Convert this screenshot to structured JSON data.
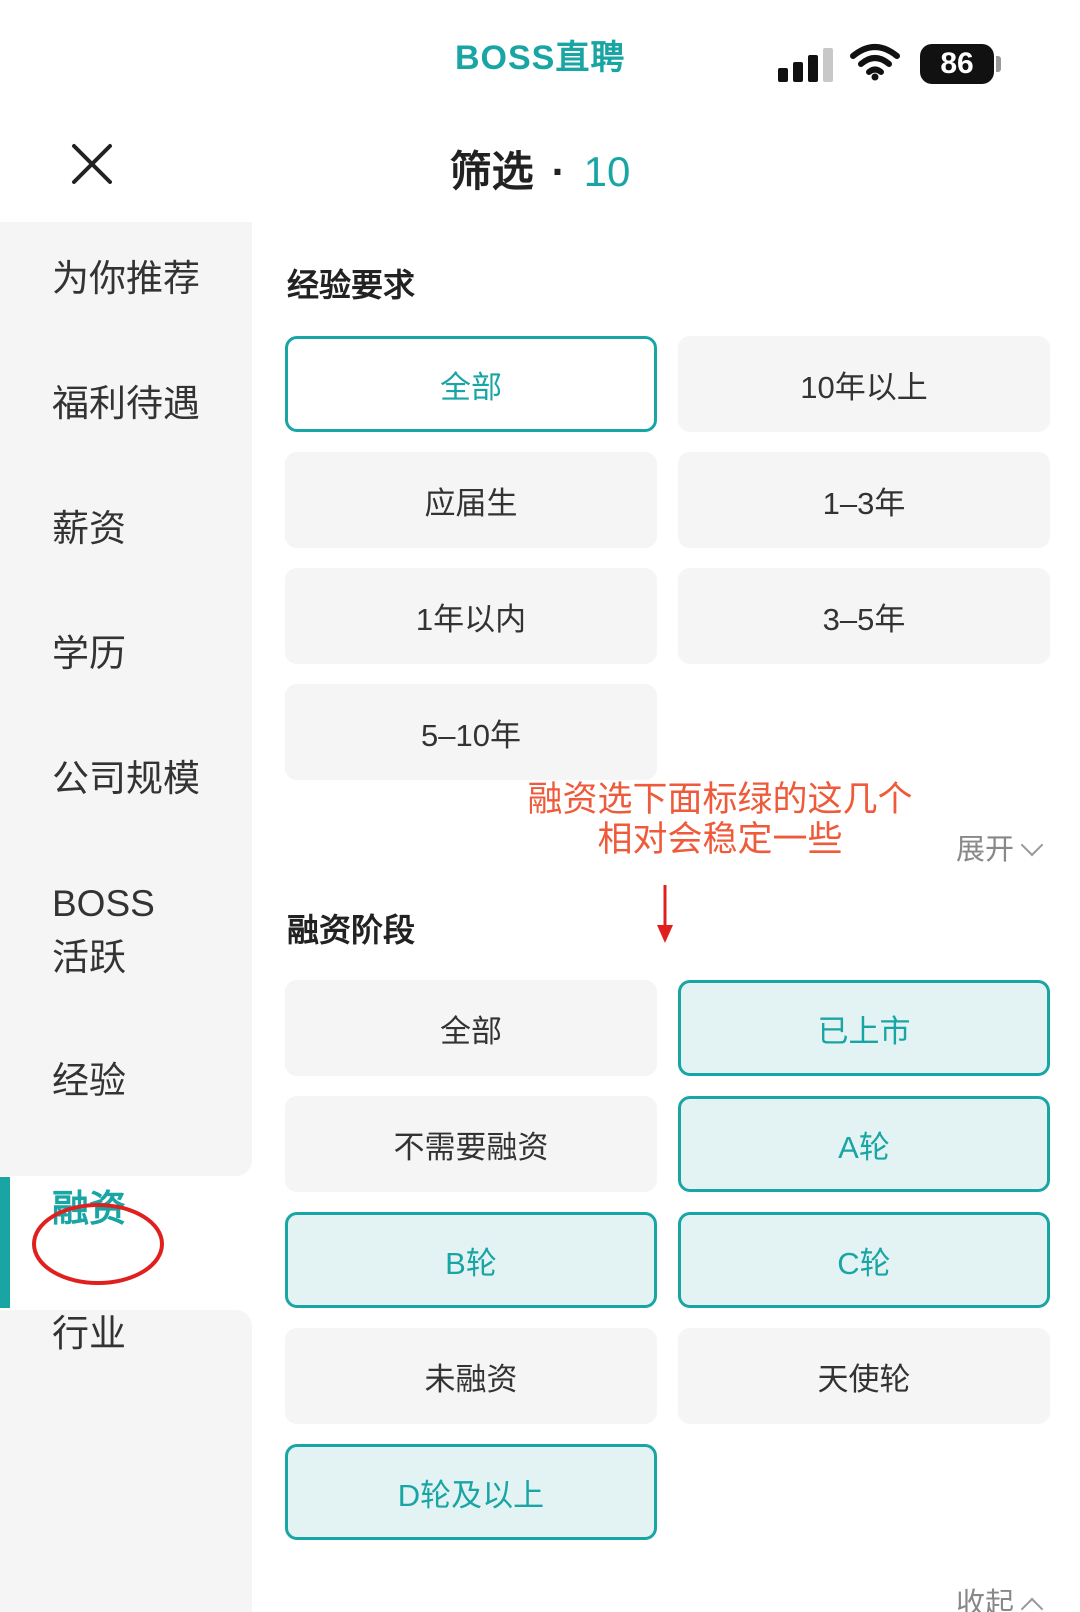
{
  "status_bar": {
    "brand": "BOSS直聘",
    "battery": "86"
  },
  "header": {
    "title": "筛选",
    "separator": "·",
    "count": "10"
  },
  "sidebar": {
    "items": [
      {
        "label": "为你推荐"
      },
      {
        "label": "福利待遇"
      },
      {
        "label": "薪资"
      },
      {
        "label": "学历"
      },
      {
        "label": "公司规模"
      },
      {
        "label": "BOSS\n活跃"
      },
      {
        "label": "经验"
      },
      {
        "label": "融资",
        "active": true
      },
      {
        "label": "行业"
      }
    ]
  },
  "experience": {
    "title": "经验要求",
    "options": [
      {
        "label": "全部",
        "selected": true
      },
      {
        "label": "10年以上"
      },
      {
        "label": "应届生"
      },
      {
        "label": "1–3年"
      },
      {
        "label": "1年以内"
      },
      {
        "label": "3–5年"
      },
      {
        "label": "5–10年"
      }
    ],
    "expand_label": "展开"
  },
  "annotation": {
    "line1": "融资选下面标绿的这几个",
    "line2": "相对会稳定一些"
  },
  "funding": {
    "title": "融资阶段",
    "options": [
      {
        "label": "全部"
      },
      {
        "label": "已上市",
        "selected": true
      },
      {
        "label": "不需要融资"
      },
      {
        "label": "A轮",
        "selected": true
      },
      {
        "label": "B轮",
        "selected": true
      },
      {
        "label": "C轮",
        "selected": true
      },
      {
        "label": "未融资"
      },
      {
        "label": "天使轮"
      },
      {
        "label": "D轮及以上",
        "selected": true
      }
    ],
    "collapse_label": "收起"
  },
  "colors": {
    "accent": "#1aa5a5",
    "selected_fill": "#e3f3f4",
    "annotation": "#ee5a3a",
    "markup_red": "#e0201f"
  }
}
